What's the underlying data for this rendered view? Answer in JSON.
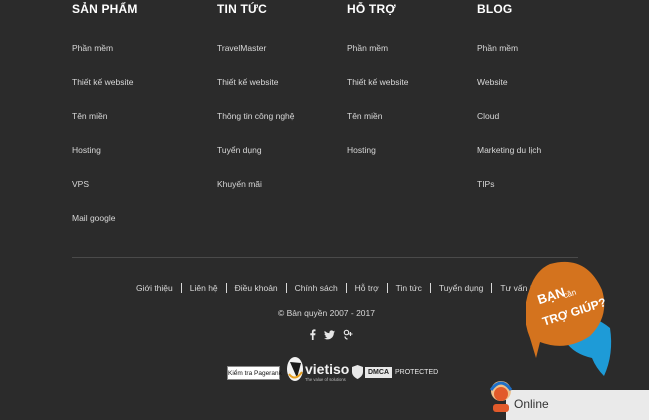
{
  "columns": [
    {
      "title": "SẢN PHẨM",
      "items": [
        "Phần mềm",
        "Thiết kế website",
        "Tên miền",
        "Hosting",
        "VPS",
        "Mail google"
      ]
    },
    {
      "title": "TIN TỨC",
      "items": [
        "TravelMaster",
        "Thiết kế website",
        "Thông tin công nghệ",
        "Tuyển dụng",
        "Khuyến mãi"
      ]
    },
    {
      "title": "HỖ TRỢ",
      "items": [
        "Phần mềm",
        "Thiết kế website",
        "Tên miền",
        "Hosting"
      ]
    },
    {
      "title": "BLOG",
      "items": [
        "Phần mềm",
        "Website",
        "Cloud",
        "Marketing du lịch",
        "TIPs"
      ]
    }
  ],
  "bottom_nav": [
    "Giới thiệu",
    "Liên hệ",
    "Điều khoản",
    "Chính sách",
    "Hỗ trợ",
    "Tin tức",
    "Tuyển dụng",
    "Tư vấn SEO"
  ],
  "copyright": "© Bản quyền 2007 - 2017",
  "social_icons": [
    "facebook-icon",
    "twitter-icon",
    "google-plus-icon"
  ],
  "badges": {
    "pagerank": "Kiểm tra Pagerank",
    "vietiso_name": "vietiso",
    "vietiso_tagline": "The value of solutions",
    "dmca": "DMCA",
    "dmca_protected": "PROTECTED"
  },
  "help_widget": {
    "line1": "BẠN",
    "line2": "cần",
    "line3": "TRỢ GIÚP?",
    "bubble_color": "#d4731e",
    "accent_color": "#1e9bd7"
  },
  "chat": {
    "status": "Online"
  }
}
